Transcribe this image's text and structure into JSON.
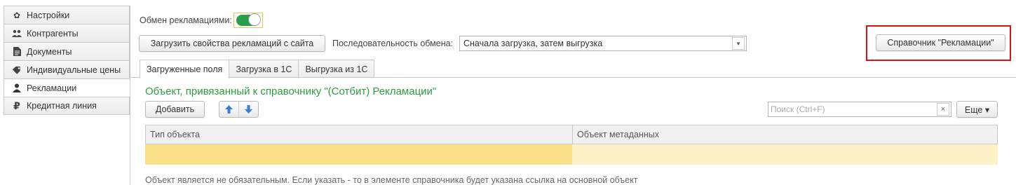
{
  "sidebar": {
    "items": [
      {
        "label": "Настройки",
        "icon": "gear-icon"
      },
      {
        "label": "Контрагенты",
        "icon": "users-icon"
      },
      {
        "label": "Документы",
        "icon": "document-icon"
      },
      {
        "label": "Индивидуальные цены",
        "icon": "price-tag-icon"
      },
      {
        "label": "Рекламации",
        "icon": "person-icon"
      },
      {
        "label": "Кредитная линия",
        "icon": "ruble-icon"
      }
    ],
    "active_index": 4
  },
  "exchange": {
    "label": "Обмен рекламациями:",
    "enabled": true
  },
  "toolbar": {
    "load_button": "Загрузить свойства рекламаций с сайта",
    "sequence_label": "Последовательность обмена:",
    "sequence_value": "Сначала загрузка, затем выгрузка",
    "reference_button": "Справочник \"Рекламации\""
  },
  "tabs": [
    {
      "label": "Загруженные поля",
      "active": true
    },
    {
      "label": "Загрузка в 1С",
      "active": false
    },
    {
      "label": "Выгрузка из 1С",
      "active": false
    }
  ],
  "section": {
    "title": "Объект, привязанный к справочнику \"(Сотбит) Рекламации\"",
    "add_button": "Добавить",
    "search_placeholder": "Поиск (Ctrl+F)",
    "more_button": "Еще ▾"
  },
  "table": {
    "columns": [
      "Тип объекта",
      "Объект метаданных"
    ],
    "rows": [
      [
        "",
        ""
      ]
    ]
  },
  "footnote": "Объект является не обязательным. Если указать - то в элементе справочника будет указана ссылка на основной объект",
  "colors": {
    "accent_green": "#2e9e3f",
    "toggle_on": "#2a9d4a",
    "highlight_red": "#dd1111",
    "row_selected": "#fbe08a"
  }
}
